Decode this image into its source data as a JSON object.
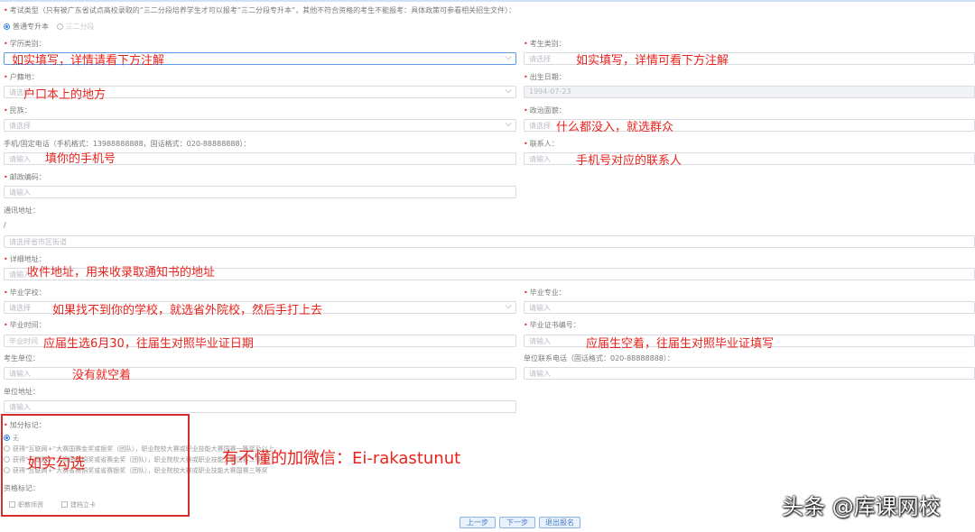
{
  "exam_type": {
    "label": "考试类型（只有被广东省试点高校录取的“三二分段培养学生才可以报考“三二分段专升本”，其他不符合资格的考生不能报考：具体政策可参看相关招生文件）：",
    "options": [
      "普通专升本",
      "三二分段"
    ],
    "selected": "普通专升本"
  },
  "fields": {
    "education": {
      "label": "学历类别：",
      "placeholder": ""
    },
    "examinee_type": {
      "label": "考生类别：",
      "placeholder": "请选择"
    },
    "household": {
      "label": "户籍地：",
      "placeholder": "请选择"
    },
    "birthdate": {
      "label": "出生日期：",
      "value": "1994-07-23"
    },
    "ethnicity": {
      "label": "民族：",
      "placeholder": "请选择"
    },
    "political": {
      "label": "政治面貌：",
      "placeholder": "请选择"
    },
    "phone": {
      "label": "手机/固定电话（手机格式：13988888888，固话格式：020-88888888）：",
      "placeholder": "请输入"
    },
    "contact": {
      "label": "联系人：",
      "placeholder": "请输入"
    },
    "postal": {
      "label": "邮政编码：",
      "placeholder": "请输入"
    },
    "address": {
      "label": "通讯地址：",
      "separator": "/",
      "placeholder": "请选择省市区街道"
    },
    "detail_address": {
      "label": "详细地址：",
      "placeholder": "请输入"
    },
    "school": {
      "label": "毕业学校：",
      "placeholder": "请选择"
    },
    "major": {
      "label": "毕业专业：",
      "placeholder": "请输入"
    },
    "grad_time": {
      "label": "毕业时间：",
      "placeholder": "毕业时间"
    },
    "cert_no": {
      "label": "毕业证书编号：",
      "placeholder": "请输入"
    },
    "employer": {
      "label": "考生单位：",
      "placeholder": "请输入"
    },
    "employer_phone": {
      "label": "单位联系电话（固话格式：020-88888888）：",
      "placeholder": "请输入"
    },
    "employer_address": {
      "label": "单位地址：",
      "placeholder": "请输入"
    }
  },
  "bonus": {
    "label": "加分标记：",
    "options": [
      "无",
      "获得“互联网+”大赛国赛金奖或银奖（团队），职业院校大赛或职业技能大赛国赛一等奖及以上",
      "获得“互联网+”大赛国赛铜奖或省赛金奖（团队），职业院校大赛或职业技能大赛国赛二等奖",
      "获得“互联网+”大赛省赛铜奖或省赛银奖（团队），职业院校大赛或职业技能大赛国赛三等奖"
    ]
  },
  "qualification": {
    "label": "资格标记：",
    "options": [
      "职教师资",
      "建档立卡"
    ]
  },
  "buttons": {
    "prev": "上一步",
    "next": "下一步",
    "exit": "退出报名"
  },
  "annotations": {
    "education": "如实填写，详情请看下方注解",
    "examinee_type": "如实填写，详情可看下方注解",
    "household": "户口本上的地方",
    "political": "什么都没入，就选群众",
    "phone": "填你的手机号",
    "contact": "手机号对应的联系人",
    "detail_address": "收件地址，用来收录取通知书的地址",
    "school": "如果找不到你的学校，就选省外院校，然后手打上去",
    "grad_time": "应届生选6月30，往届生对照毕业证日期",
    "cert_no": "应届生空着，往届生对照毕业证填写",
    "employer": "没有就空着",
    "bonus": "如实勾选",
    "wechat": "有不懂的加微信：Ei-rakastunut"
  },
  "watermark": "头条 @库课网校",
  "colors": {
    "annotation": "#e8231c",
    "accent": "#3a85e6",
    "box": "#d32f2f"
  }
}
